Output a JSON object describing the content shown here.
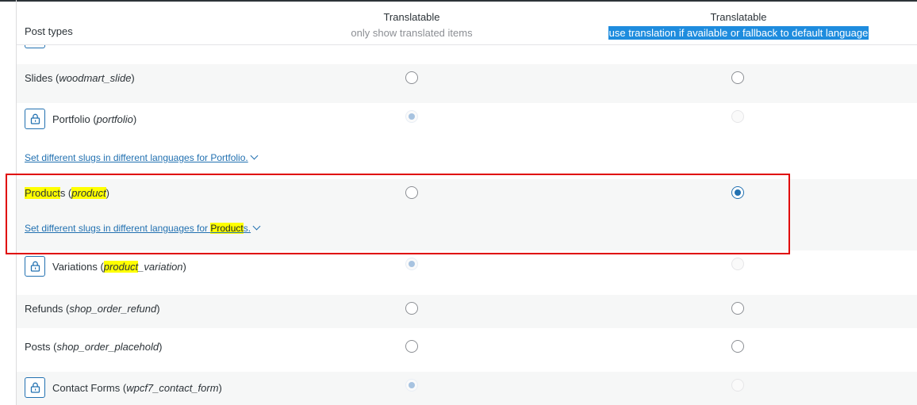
{
  "header": {
    "post_types_label": "Post types",
    "col1_title": "Translatable",
    "col1_subtitle": "only show translated items",
    "col2_title": "Translatable",
    "col2_subtitle": "use translation if available or fallback to default language"
  },
  "rows": [
    {
      "name": "Slides",
      "slug": "woodmart_slide",
      "locked": false,
      "col1": "unchecked",
      "col2": "unchecked"
    },
    {
      "name": "Portfolio",
      "slug": "portfolio",
      "locked": true,
      "col1": "checked-disabled",
      "col2": "disabled",
      "slug_link": "Set different slugs in different languages for Portfolio."
    },
    {
      "name_hl": "Product",
      "name_rest": "s",
      "slug_hl": "product",
      "locked": false,
      "col1": "unchecked",
      "col2": "checked",
      "slug_link_pre": "Set different slugs in different languages for ",
      "slug_link_hl": "Product",
      "slug_link_post": "s."
    },
    {
      "name": "Variations",
      "slug_hl": "product",
      "slug_rest": "_variation",
      "locked": true,
      "col1": "checked-disabled",
      "col2": "disabled"
    },
    {
      "name": "Refunds",
      "slug": "shop_order_refund",
      "locked": false,
      "col1": "unchecked",
      "col2": "unchecked"
    },
    {
      "name": "Posts",
      "slug": "shop_order_placehold",
      "locked": false,
      "col1": "unchecked",
      "col2": "unchecked"
    },
    {
      "name": "Contact Forms",
      "slug": "wpcf7_contact_form",
      "locked": true,
      "col1": "checked-disabled",
      "col2": "disabled"
    }
  ],
  "icons": {
    "lock": "lock-icon",
    "chevron": "chevron-down-icon"
  },
  "colors": {
    "accent": "#2271b1",
    "highlight": "#ffff00",
    "selection": "#1e8cde",
    "annotation": "#e00000"
  }
}
